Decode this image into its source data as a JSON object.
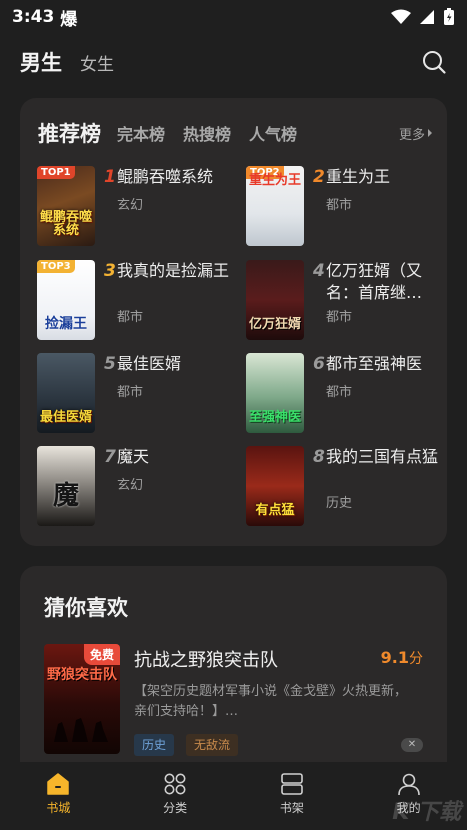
{
  "status": {
    "time": "3:43",
    "notify_glyph": "爆"
  },
  "top_nav": {
    "tabs": [
      "男生",
      "女生"
    ]
  },
  "rank": {
    "title": "推荐榜",
    "subtabs": [
      "完本榜",
      "热搜榜",
      "人气榜"
    ],
    "more": "更多",
    "books": [
      {
        "rank": "1",
        "badge": "TOP1",
        "title": "鲲鹏吞噬系统",
        "category": "玄幻",
        "cover_text": "鲲鹏吞噬系统"
      },
      {
        "rank": "2",
        "badge": "TOP2",
        "title": "重生为王",
        "category": "都市",
        "cover_text": "重生为王"
      },
      {
        "rank": "3",
        "badge": "TOP3",
        "title": "我真的是捡漏王",
        "category": "都市",
        "cover_text": "捡漏王"
      },
      {
        "rank": "4",
        "badge": "",
        "title": "亿万狂婿（又名：首席继…",
        "category": "都市",
        "cover_text": "亿万狂婿"
      },
      {
        "rank": "5",
        "badge": "",
        "title": "最佳医婿",
        "category": "都市",
        "cover_text": "最佳医婿"
      },
      {
        "rank": "6",
        "badge": "",
        "title": "都市至强神医",
        "category": "都市",
        "cover_text": "至强神医"
      },
      {
        "rank": "7",
        "badge": "",
        "title": "魔天",
        "category": "玄幻",
        "cover_text": "魔"
      },
      {
        "rank": "8",
        "badge": "",
        "title": "我的三国有点猛",
        "category": "历史",
        "cover_text": "有点猛"
      }
    ]
  },
  "guess": {
    "title": "猜你喜欢",
    "book": {
      "free_badge": "免费",
      "cover_text": "野狼突击队",
      "title": "抗战之野狼突击队",
      "score": "9.1",
      "score_unit": "分",
      "desc": "【架空历史题材军事小说《金戈壁》火热更新，亲们支持哈！】…",
      "tags": [
        "历史",
        "无敌流"
      ]
    }
  },
  "bottom_nav": {
    "items": [
      "书城",
      "分类",
      "书架",
      "我的"
    ]
  },
  "colors": {
    "accent": "#f6b52b",
    "rank_1": "#e0452a",
    "rank_2": "#f0892b",
    "rank_3": "#f3b233",
    "rank_other": "#9a9a9a"
  },
  "watermark": "K 下载"
}
